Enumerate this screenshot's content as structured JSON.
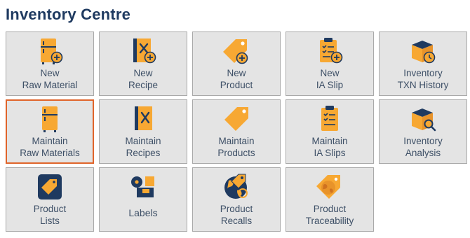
{
  "header": {
    "title": "Inventory Centre"
  },
  "accent_color": "#f7a833",
  "dark_color": "#1f3a60",
  "selected_border_color": "#e0642a",
  "tiles": [
    {
      "icon": "fridge-plus-icon",
      "lines": [
        "New",
        "Raw Material"
      ],
      "selected": false
    },
    {
      "icon": "recipe-book-plus-icon",
      "lines": [
        "New",
        "Recipe"
      ],
      "selected": false
    },
    {
      "icon": "tag-plus-icon",
      "lines": [
        "New",
        "Product"
      ],
      "selected": false
    },
    {
      "icon": "clipboard-plus-icon",
      "lines": [
        "New",
        "IA Slip"
      ],
      "selected": false
    },
    {
      "icon": "box-clock-icon",
      "lines": [
        "Inventory",
        "TXN History"
      ],
      "selected": false
    },
    {
      "icon": "fridge-icon",
      "lines": [
        "Maintain",
        "Raw Materials"
      ],
      "selected": true
    },
    {
      "icon": "recipe-book-icon",
      "lines": [
        "Maintain",
        "Recipes"
      ],
      "selected": false
    },
    {
      "icon": "tag-icon",
      "lines": [
        "Maintain",
        "Products"
      ],
      "selected": false
    },
    {
      "icon": "clipboard-icon",
      "lines": [
        "Maintain",
        "IA Slips"
      ],
      "selected": false
    },
    {
      "icon": "box-search-icon",
      "lines": [
        "Inventory",
        "Analysis"
      ],
      "selected": false
    },
    {
      "icon": "product-list-icon",
      "lines": [
        "Product",
        "Lists"
      ],
      "selected": false
    },
    {
      "icon": "label-roll-icon",
      "lines": [
        "Labels"
      ],
      "selected": false
    },
    {
      "icon": "globe-recall-icon",
      "lines": [
        "Product",
        "Recalls"
      ],
      "selected": false
    },
    {
      "icon": "globe-tag-icon",
      "lines": [
        "Product",
        "Traceability"
      ],
      "selected": false
    }
  ]
}
